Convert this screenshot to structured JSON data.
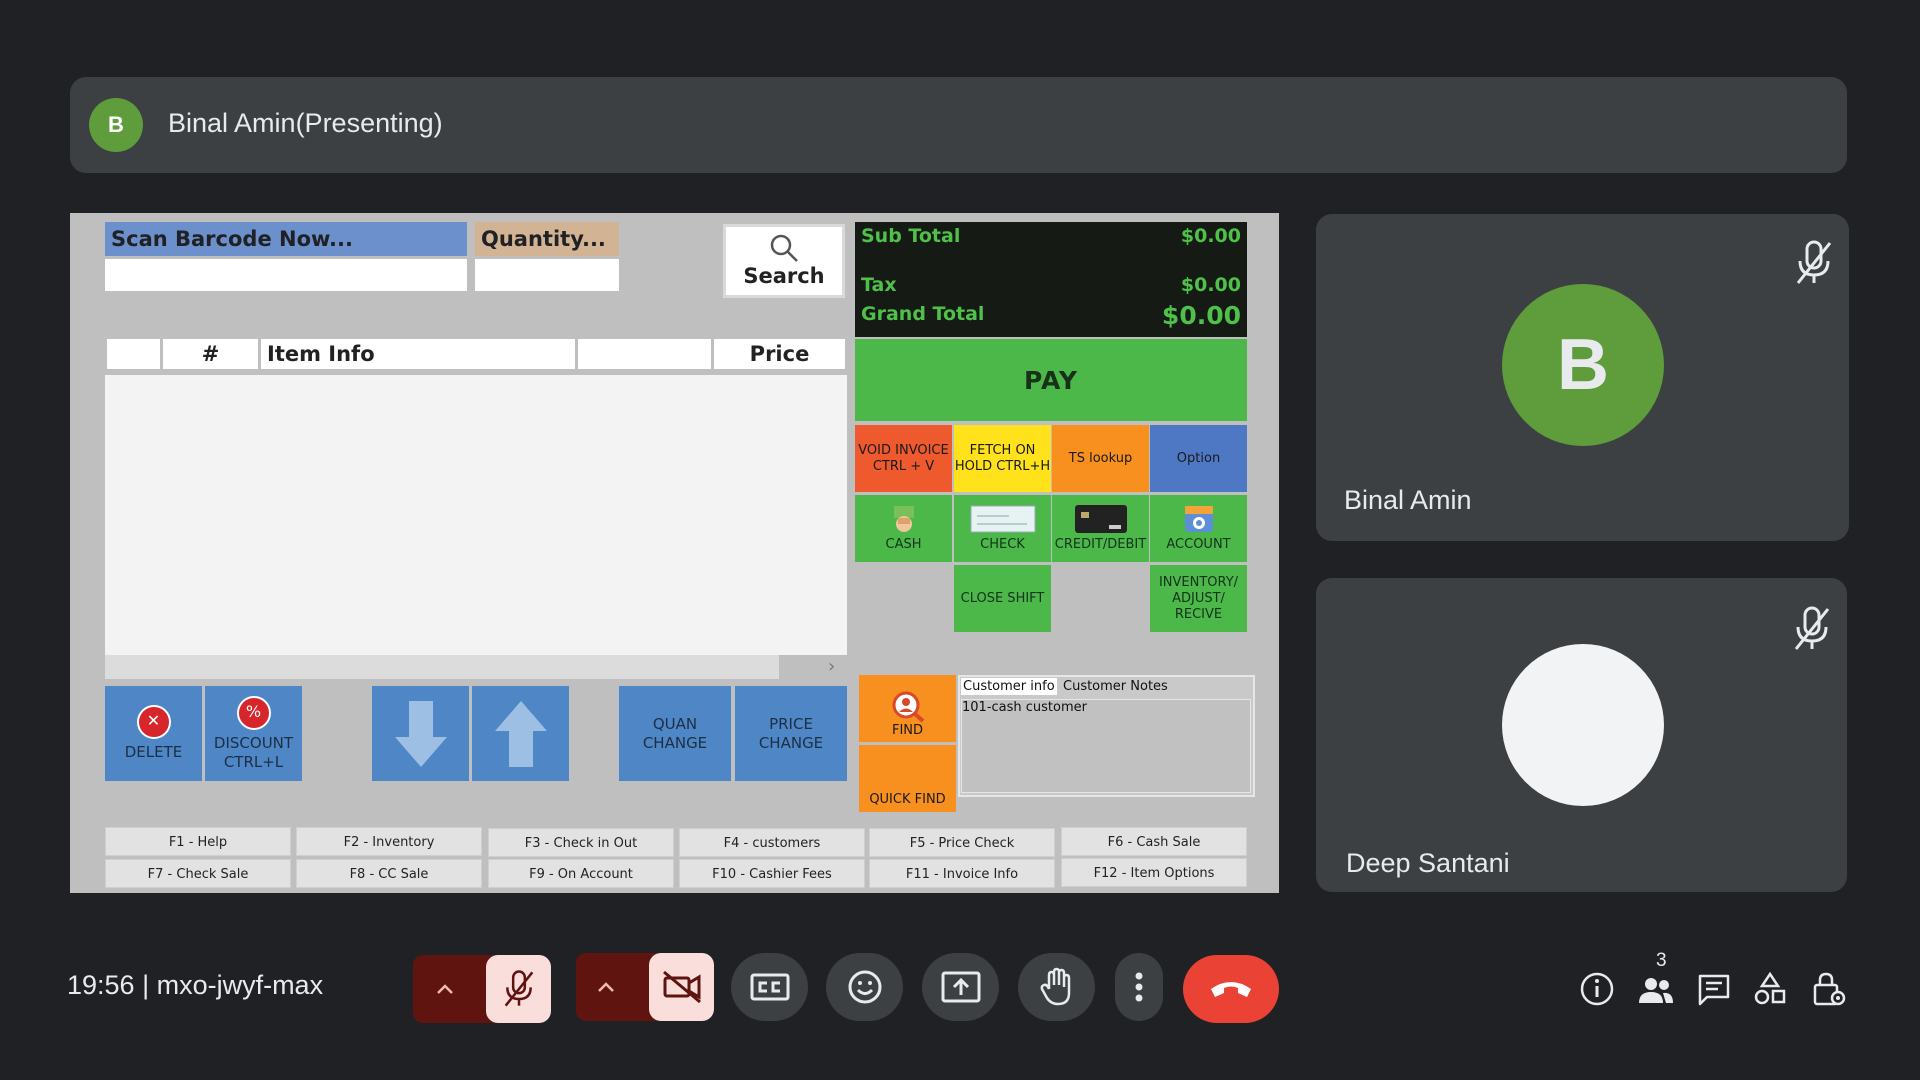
{
  "presenter": {
    "initial": "B",
    "name": "Binal Amin(Presenting)"
  },
  "pos": {
    "barcode_label": "Scan Barcode Now...",
    "quantity_label": "Quantity...",
    "search_label": "Search",
    "columns": [
      "",
      "#",
      "Item Info",
      "",
      "Price"
    ],
    "totals": {
      "sub_total_label": "Sub Total",
      "sub_total_value": "$0.00",
      "tax_label": "Tax",
      "tax_value": "$0.00",
      "grand_total_label": "Grand Total",
      "grand_total_value": "$0.00"
    },
    "pay_label": "PAY",
    "tiles": {
      "void": "VOID INVOICE CTRL + V",
      "fetch": "FETCH ON HOLD CTRL+H",
      "ts_lookup": "TS lookup",
      "option": "Option",
      "cash": "CASH",
      "check": "CHECK",
      "credit": "CREDIT/DEBIT",
      "account": "ACCOUNT",
      "close_shift": "CLOSE SHIFT",
      "inventory": "INVENTORY/ ADJUST/ RECIVE"
    },
    "buttons": {
      "delete": "DELETE",
      "discount": "DISCOUNT CTRL+L",
      "quan_change": "QUAN CHANGE",
      "price_change": "PRICE CHANGE",
      "find": "FIND",
      "quick_find": "QUICK FIND"
    },
    "customer": {
      "tab_info": "Customer info",
      "tab_notes": "Customer Notes",
      "value": "101-cash customer"
    },
    "function_keys": [
      "F1 - Help",
      "F2 - Inventory",
      "F3 - Check in Out",
      "F4 - customers",
      "F5 - Price Check",
      "F6 - Cash Sale",
      "F7 - Check Sale",
      "F8 - CC Sale",
      "F9 - On Account",
      "F10 - Cashier Fees",
      "F11 - Invoice Info",
      "F12 - Item Options"
    ]
  },
  "participants": [
    {
      "initial": "B",
      "name": "Binal Amin",
      "avatar_color": "#5e9c3c"
    },
    {
      "initial": "",
      "name": "Deep Santani",
      "avatar_color": "#f1f3f4"
    }
  ],
  "meeting": {
    "info": "19:56 | mxo-jwyf-max",
    "people_count": "3"
  },
  "colors": {
    "background": "#202124",
    "tile": "#3c4043",
    "end_call": "#ea4335",
    "muted": "#f9dedc",
    "muted_dark": "#601410"
  }
}
